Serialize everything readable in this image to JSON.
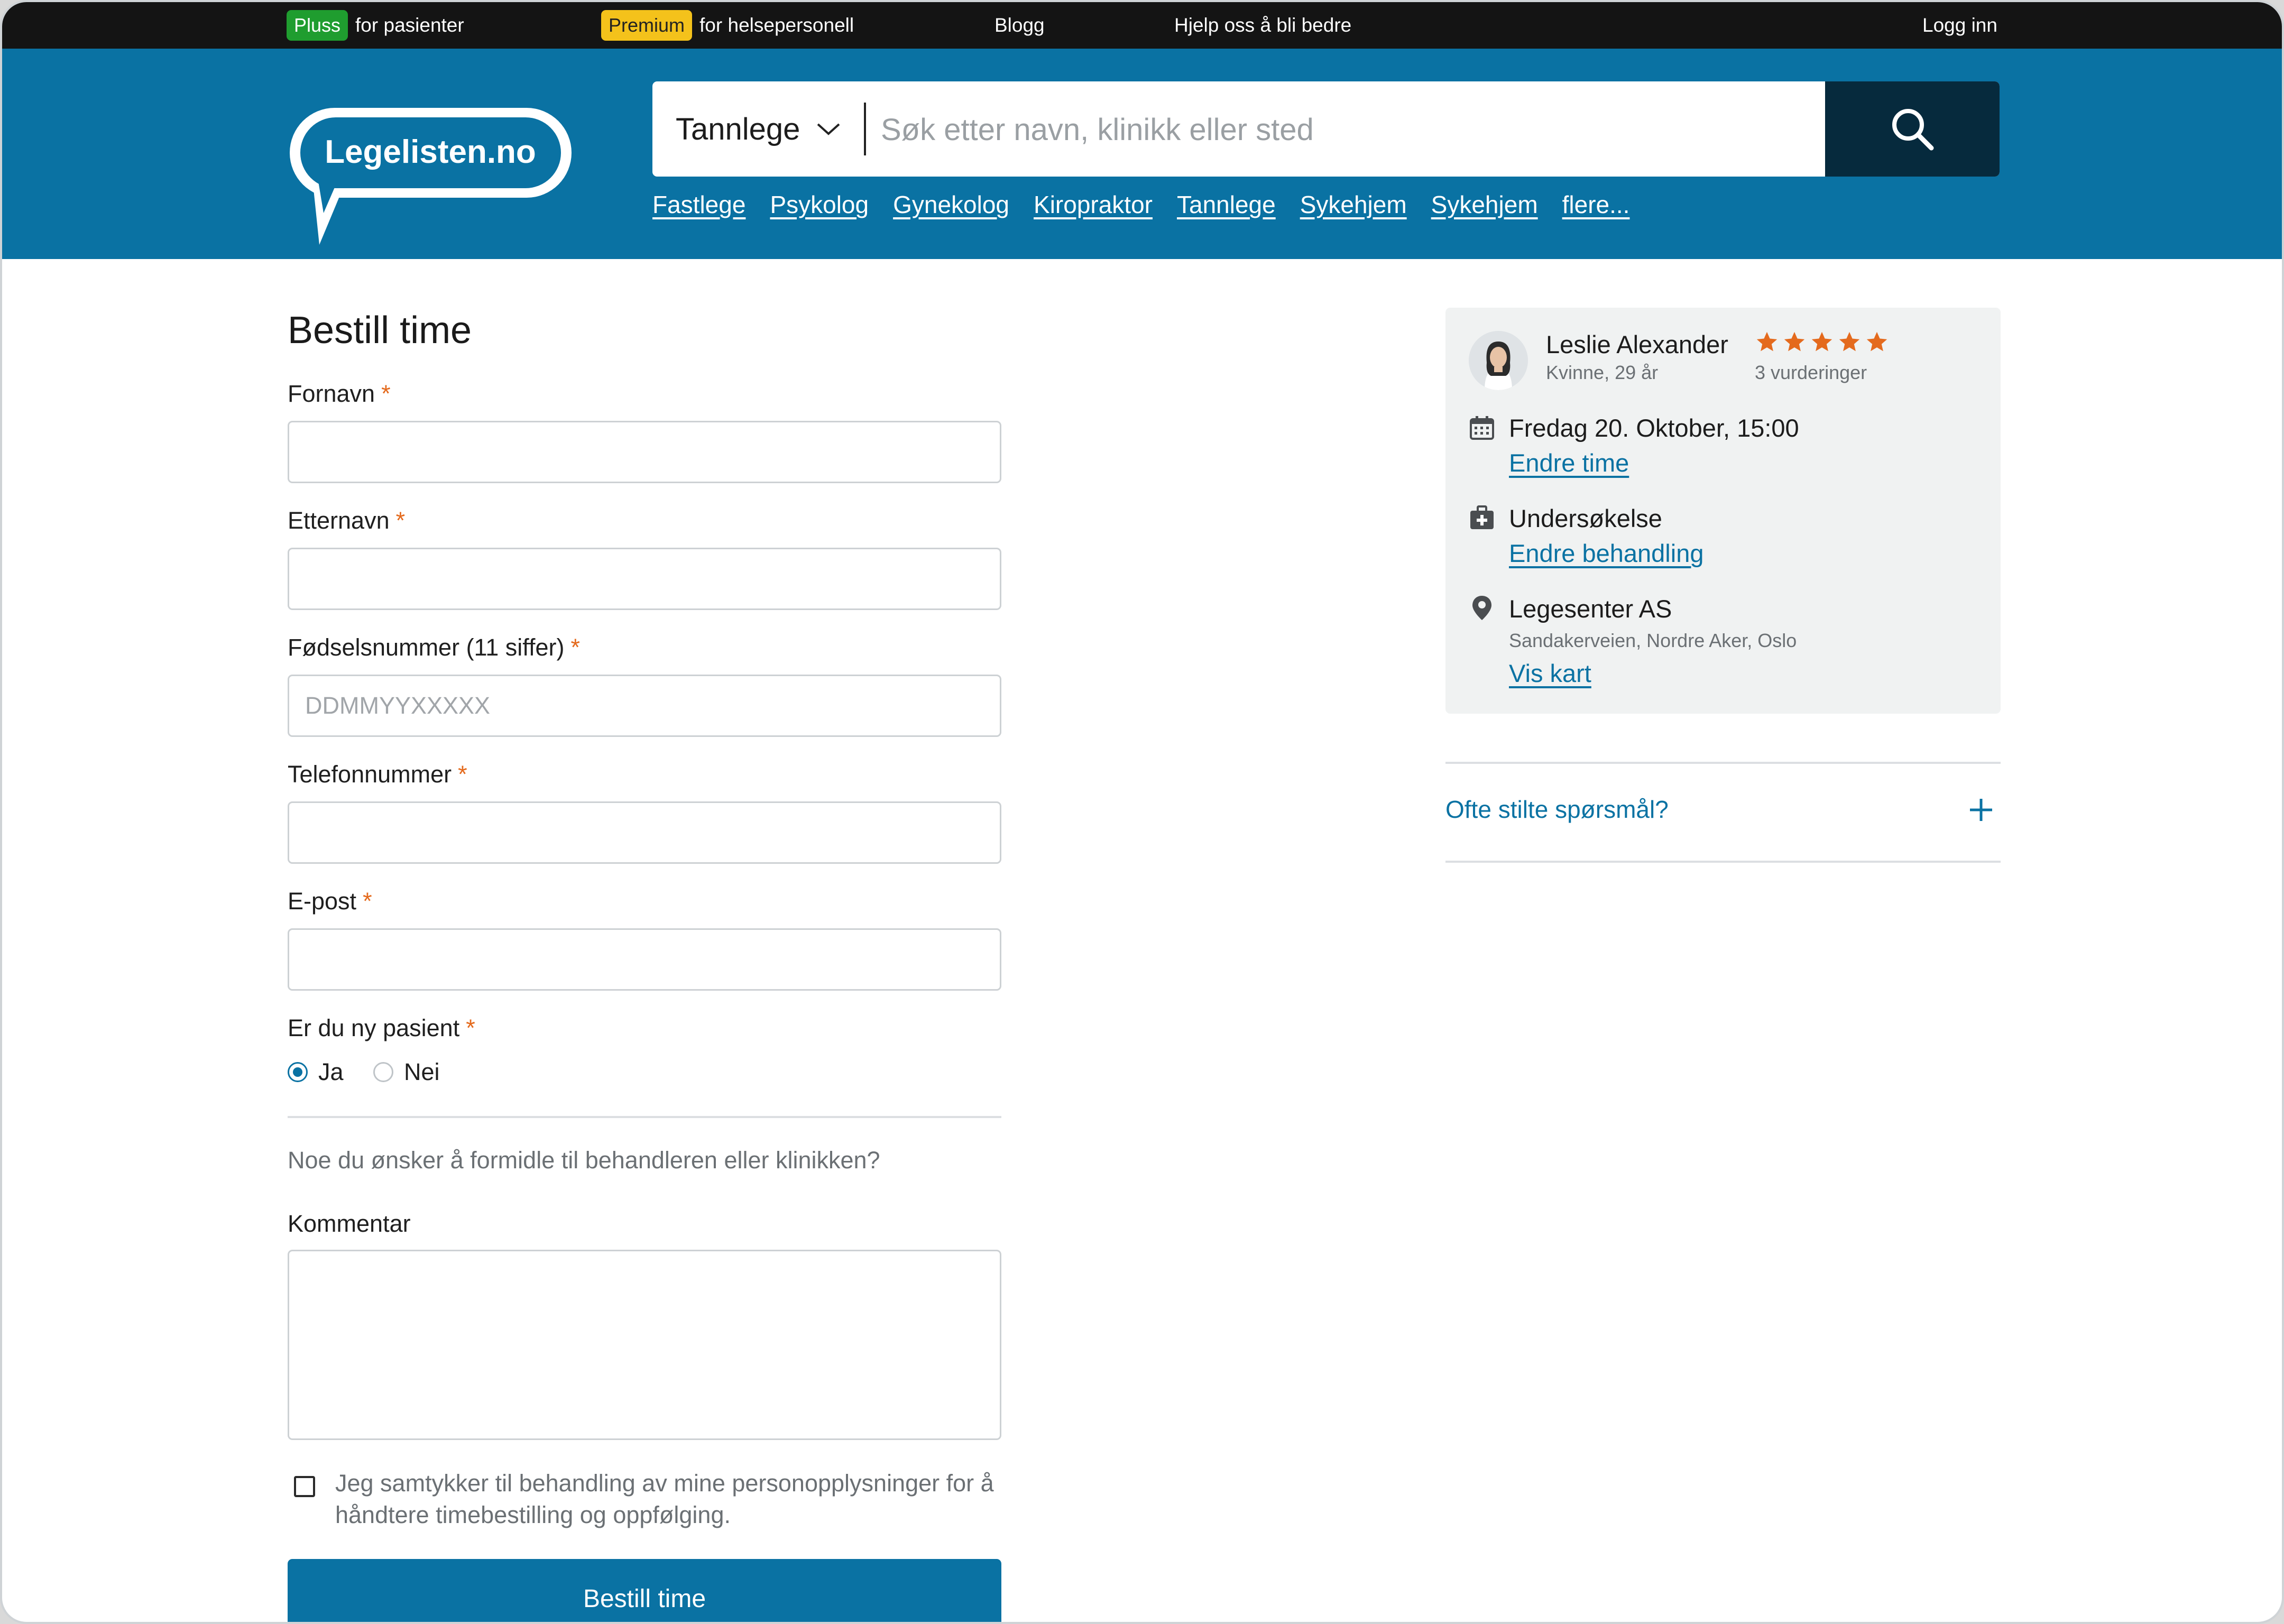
{
  "topbar": {
    "pluss_badge": "Pluss",
    "pluss_text": "for pasienter",
    "premium_badge": "Premium",
    "premium_text": "for helsepersonell",
    "blog": "Blogg",
    "help": "Hjelp oss å bli bedre",
    "login": "Logg inn"
  },
  "header": {
    "logo_text": "Legelisten.no",
    "category": "Tannlege",
    "search_placeholder": "Søk etter navn, klinikk eller sted",
    "nav": [
      "Fastlege",
      "Psykolog",
      "Gynekolog",
      "Kiropraktor",
      "Tannlege",
      "Sykehjem",
      "Sykehjem",
      "flere..."
    ]
  },
  "form": {
    "title": "Bestill time",
    "required_mark": "*",
    "first_name_label": "Fornavn",
    "last_name_label": "Etternavn",
    "ssn_label": "Fødselsnummer (11 siffer)",
    "ssn_placeholder": "DDMMYYXXXXX",
    "phone_label": "Telefonnummer",
    "email_label": "E-post",
    "new_patient_label": "Er du ny pasient",
    "yes": "Ja",
    "no": "Nei",
    "note": "Noe du ønsker å formidle til behandleren eller klinikken?",
    "comment_label": "Kommentar",
    "consent": "Jeg samtykker til behandling av mine personopplysninger for å håndtere timebestilling og oppfølging.",
    "submit": "Bestill time"
  },
  "card": {
    "name": "Leslie Alexander",
    "meta": "Kvinne, 29 år",
    "rating_stars": 5,
    "rating_count": "3 vurderinger",
    "datetime": "Fredag 20. Oktober, 15:00",
    "change_time": "Endre time",
    "treatment": "Undersøkelse",
    "change_treatment": "Endre behandling",
    "clinic": "Legesenter AS",
    "address": "Sandakerveien, Nordre Aker, Oslo",
    "map_link": "Vis kart"
  },
  "faq": {
    "label": "Ofte stilte spørsmål?"
  },
  "colors": {
    "brand_blue": "#0a72a3",
    "dark_navy": "#062a3d",
    "star_orange": "#e46a1d",
    "pluss_green": "#1f9d2f",
    "premium_yellow": "#f4c21b"
  }
}
